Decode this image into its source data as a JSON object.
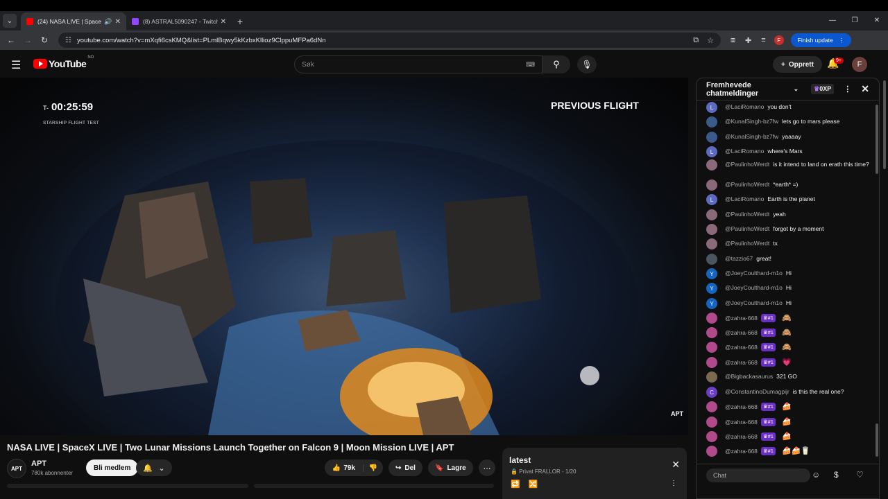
{
  "browser": {
    "tabs": [
      {
        "title": "(24) NASA LIVE | SpaceX LIV",
        "active": true,
        "favicon_color": "#ff0000"
      },
      {
        "title": "(8) ASTRAL5090247 - Twitch",
        "active": false,
        "favicon_color": "#9146ff"
      }
    ],
    "url": "youtube.com/watch?v=mXqfi6csKMQ&list=PLmlBqwy5kKzbxKllioz9ClppuMFPa6dNn",
    "profile_initial": "F",
    "finish_update": "Finish update"
  },
  "yt": {
    "logo_text": "YouTube",
    "country": "NO",
    "search_placeholder": "Søk",
    "create_label": "Opprett",
    "notif_count": "9+",
    "avatar_initial": "F"
  },
  "video": {
    "timer_prefix": "T-",
    "timer": "00:25:59",
    "subtitle": "STARSHIP FLIGHT TEST",
    "overlay_right": "PREVIOUS FLIGHT",
    "watermark": "APT",
    "title": "NASA LIVE | SpaceX LIVE | Two Lunar Missions Launch Together on Falcon 9 | Moon Mission LIVE | APT"
  },
  "channel": {
    "logo": "APT",
    "name": "APT",
    "subscribers": "780k abonnenter",
    "member_label": "Bli medlem"
  },
  "actions": {
    "likes": "79k",
    "share": "Del",
    "save": "Lagre"
  },
  "playlist": {
    "title": "latest",
    "privacy": "Privat",
    "owner_count": "FRALLOR - 1/20"
  },
  "chat": {
    "header": "Fremhevede chatmeldinger",
    "xp": "0XP",
    "input_placeholder": "Chat",
    "messages": [
      {
        "author": "@LaciRomano",
        "text": "you don't",
        "initial": "L",
        "color": "#5c6bc0"
      },
      {
        "author": "@KunalSingh-bz7fw",
        "text": "lets go to mars please",
        "initial": "",
        "color": "#3a5a8a"
      },
      {
        "author": "@KunalSingh-bz7fw",
        "text": "yaaaay",
        "initial": "",
        "color": "#3a5a8a"
      },
      {
        "author": "@LaciRomano",
        "text": "where's Mars",
        "initial": "L",
        "color": "#5c6bc0"
      },
      {
        "author": "@PaulinhoWerdt",
        "text": "is it intend to land on erath this time?",
        "initial": "",
        "color": "#8a6a7a"
      },
      {
        "author": "@PaulinhoWerdt",
        "text": "*earth* =)",
        "initial": "",
        "color": "#8a6a7a"
      },
      {
        "author": "@LaciRomano",
        "text": "Earth is the planet",
        "initial": "L",
        "color": "#5c6bc0"
      },
      {
        "author": "@PaulinhoWerdt",
        "text": "yeah",
        "initial": "",
        "color": "#8a6a7a"
      },
      {
        "author": "@PaulinhoWerdt",
        "text": "forgot by a moment",
        "initial": "",
        "color": "#8a6a7a"
      },
      {
        "author": "@PaulinhoWerdt",
        "text": "tx",
        "initial": "",
        "color": "#8a6a7a"
      },
      {
        "author": "@tazzio67",
        "text": "great!",
        "initial": "",
        "color": "#4a5560"
      },
      {
        "author": "@JoeyCoulthard-m1o",
        "text": "Hi",
        "initial": "Y",
        "color": "#1565c0"
      },
      {
        "author": "@JoeyCoulthard-m1o",
        "text": "Hi",
        "initial": "Y",
        "color": "#1565c0"
      },
      {
        "author": "@JoeyCoulthard-m1o",
        "text": "Hi",
        "initial": "Y",
        "color": "#1565c0"
      },
      {
        "author": "@zahra-668",
        "badge": "#1",
        "text": "",
        "emoji": "🙈",
        "initial": "",
        "color": "#b04a8a"
      },
      {
        "author": "@zahra-668",
        "badge": "#1",
        "text": "",
        "emoji": "🙈",
        "initial": "",
        "color": "#b04a8a"
      },
      {
        "author": "@zahra-668",
        "badge": "#1",
        "text": "",
        "emoji": "🙈",
        "initial": "",
        "color": "#b04a8a"
      },
      {
        "author": "@zahra-668",
        "badge": "#1",
        "text": "",
        "emoji": "💗",
        "initial": "",
        "color": "#b04a8a"
      },
      {
        "author": "@Bigbackasaurus",
        "text": "321 GO",
        "initial": "",
        "color": "#7a6a50"
      },
      {
        "author": "@ConstantinoDumagpijr",
        "text": "is this the real one?",
        "initial": "C",
        "color": "#6a3fc6"
      },
      {
        "author": "@zahra-668",
        "badge": "#1",
        "text": "",
        "emoji": "🍰",
        "initial": "",
        "color": "#b04a8a"
      },
      {
        "author": "@zahra-668",
        "badge": "#1",
        "text": "",
        "emoji": "🍰",
        "initial": "",
        "color": "#b04a8a"
      },
      {
        "author": "@zahra-668",
        "badge": "#1",
        "text": "",
        "emoji": "🍰",
        "initial": "",
        "color": "#b04a8a"
      },
      {
        "author": "@zahra-668",
        "badge": "#1",
        "text": "",
        "emoji": "🍰🍰🥛",
        "initial": "",
        "color": "#b04a8a"
      }
    ]
  }
}
